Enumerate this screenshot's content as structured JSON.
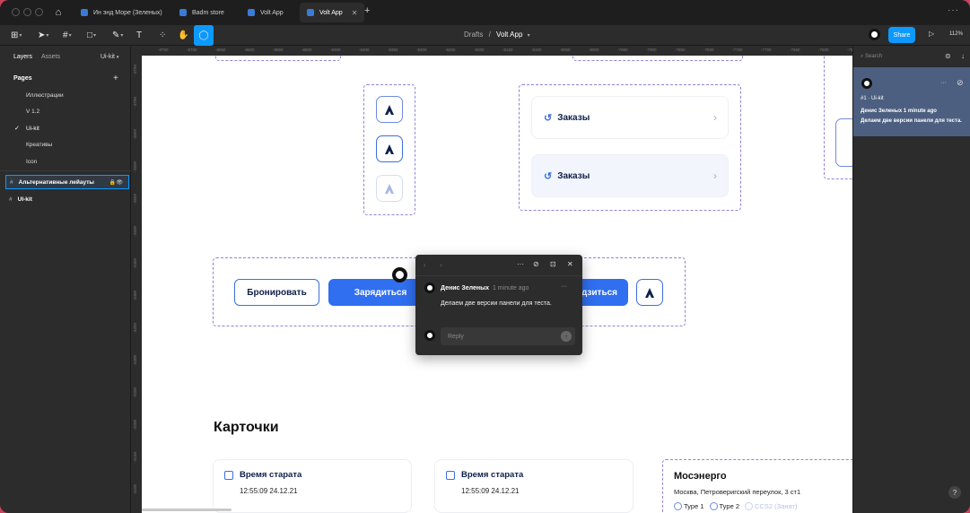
{
  "tabs": [
    {
      "label": "Ин энд Море (Зеленых)"
    },
    {
      "label": "Badm store"
    },
    {
      "label": "Volt App"
    },
    {
      "label": "Volt App"
    }
  ],
  "toolbar": {
    "text_tool": "T",
    "breadcrumb_root": "Drafts",
    "breadcrumb_sep": "/",
    "file_name": "Volt App",
    "share_label": "Share",
    "zoom": "112%"
  },
  "left_panel": {
    "tab_layers": "Layers",
    "tab_assets": "Assets",
    "kit_label": "Ui-kit",
    "pages_title": "Pages",
    "pages": [
      {
        "label": "Иллюстрации"
      },
      {
        "label": "V 1.2"
      },
      {
        "label": "Ui-kit"
      },
      {
        "label": "Креативы"
      },
      {
        "label": "Icon"
      }
    ],
    "layers": [
      {
        "label": "Альтернативные лейауты"
      },
      {
        "label": "UI-kit"
      }
    ]
  },
  "ruler": {
    "h": [
      "-8750",
      "-8700",
      "-8650",
      "-8600",
      "-8550",
      "-8500",
      "-8450",
      "-8400",
      "-8350",
      "-8300",
      "-8250",
      "-8200",
      "-8150",
      "-8100",
      "-8050",
      "-8000",
      "-7950",
      "-7900",
      "-7850",
      "-7800",
      "-7750",
      "-7700",
      "-7650",
      "-7600",
      "-7550"
    ],
    "v": [
      "-3750",
      "-3700",
      "-3650",
      "-3600",
      "-3550",
      "-3500",
      "-3450",
      "-3400",
      "-3350",
      "-3300",
      "-3250",
      "-3200",
      "-3150",
      "-3100"
    ]
  },
  "canvas": {
    "orders_label": "Заказы",
    "btn_book": "Бронировать",
    "btn_charge": "Зарядиться",
    "btn_charge_partial": "дзиться",
    "section_title": "Карточки",
    "cards": [
      {
        "title": "Время старата",
        "datetime": "12:55:09  24.12.21"
      },
      {
        "title": "Время старата",
        "datetime": "12:55:09  24.12.21"
      }
    ],
    "station": {
      "title": "Мосэнерго",
      "address": "Москва, Петроверигский переулок, 3 ст1",
      "type1": "Type 1",
      "type2": "Type 2",
      "ccs2": "CCS2 (Занят)"
    }
  },
  "comment_popup": {
    "author": "Денис Зеленых",
    "time": "1 minute ago",
    "text": "Делаем две версии панели для теста.",
    "reply_placeholder": "Reply"
  },
  "right_panel": {
    "search_placeholder": "Search",
    "comment": {
      "frame": "#1 · Ui-kit",
      "author_time": "Денис Зеленых 1 minute ago",
      "message": "Делаем две версии панели для теста."
    }
  },
  "colors": {
    "accent": "#0d99ff",
    "primary_button": "#2f6ff0",
    "dashed_frame": "#8c86d8",
    "comment_selected": "#4c5f80"
  }
}
